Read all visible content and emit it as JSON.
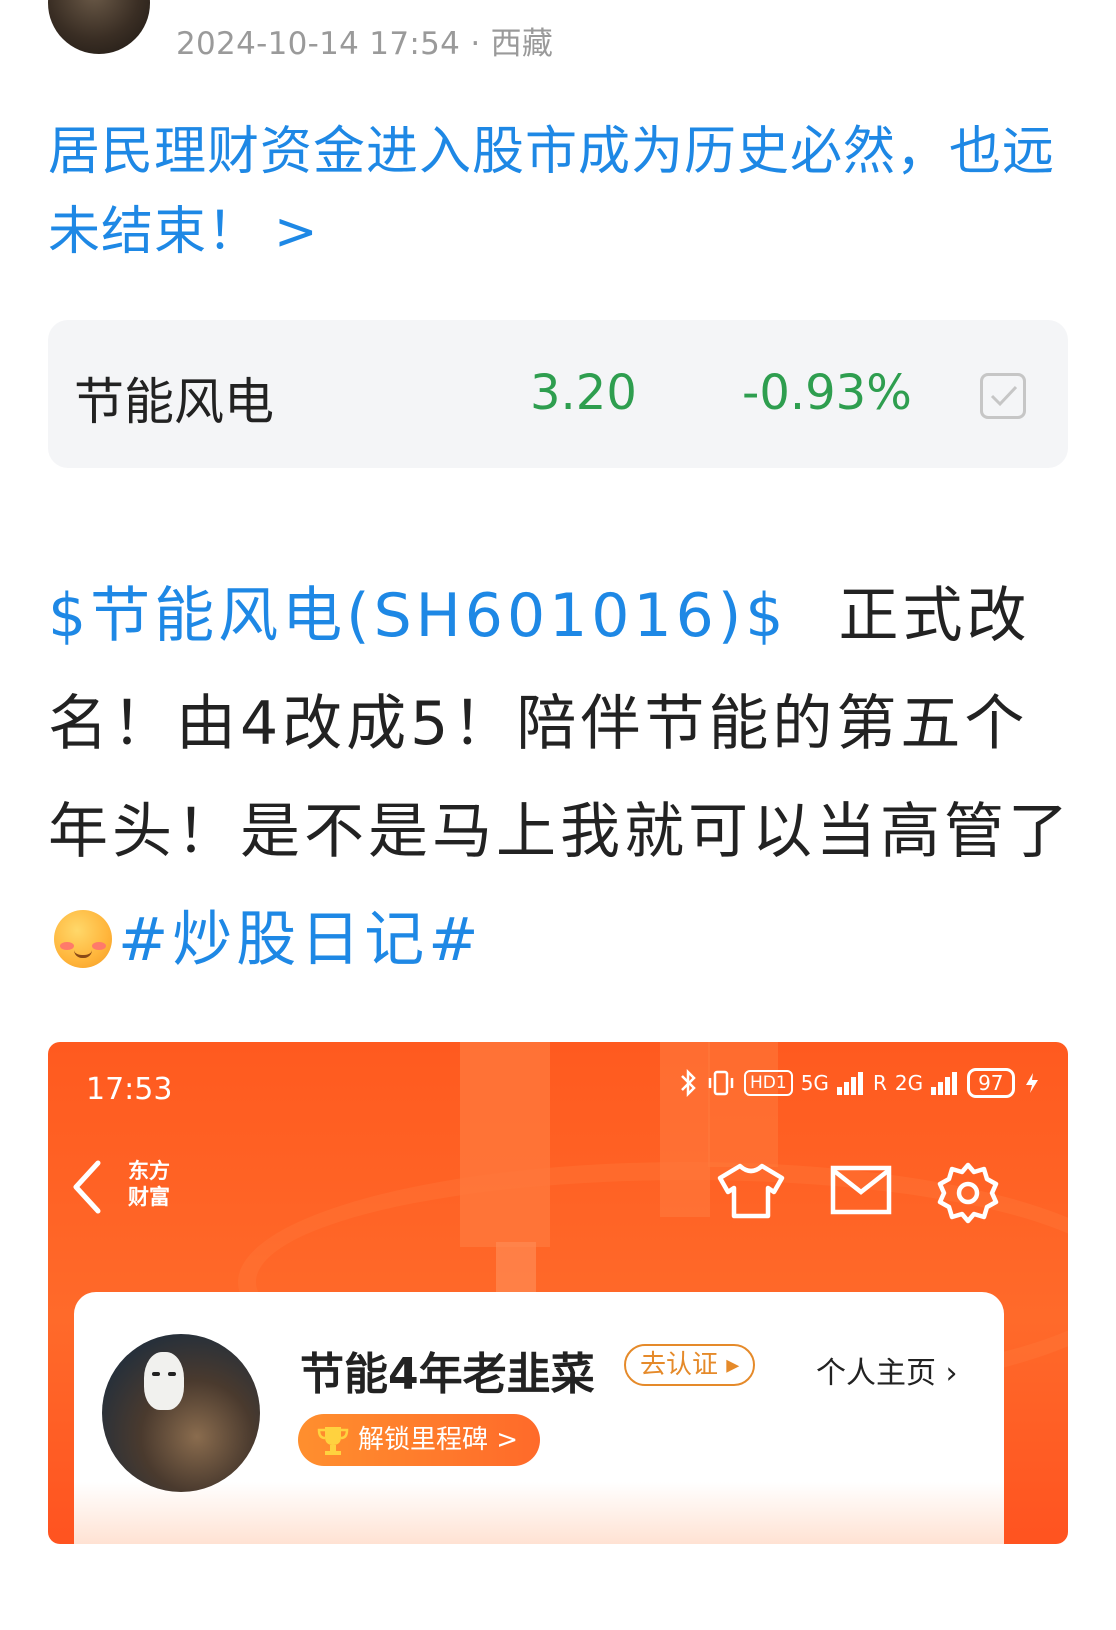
{
  "post": {
    "timestamp": "2024-10-14 17:54",
    "separator": "·",
    "location": "西藏",
    "headline": "居民理财资金进入股市成为历史必然，也远未结束！",
    "headline_arrow": ">",
    "body_link": "$节能风电(SH601016)$",
    "body_text": "正式改名！由4改成5！陪伴节能的第五个年头！是不是马上我就可以当高管了",
    "emoji": "shy-blush-emoji",
    "hashtag": "#炒股日记#"
  },
  "stock": {
    "name": "节能风电",
    "price": "3.20",
    "change": "-0.93%",
    "color": "#2e9e4f"
  },
  "screenshot": {
    "time": "17:53",
    "hd": "HD1",
    "net1": "5G",
    "net2": "2G",
    "roaming": "R",
    "battery": "97",
    "brand_line1": "东方",
    "brand_line2": "财富",
    "username": "节能4年老韭菜",
    "verify_label": "去认证 ▸",
    "homepage_label": "个人主页 ›",
    "badge_label": "解锁里程碑 >",
    "accent": "#ff5a1f"
  },
  "colors": {
    "link": "#1e88e5",
    "meta": "#9a9a9a"
  }
}
